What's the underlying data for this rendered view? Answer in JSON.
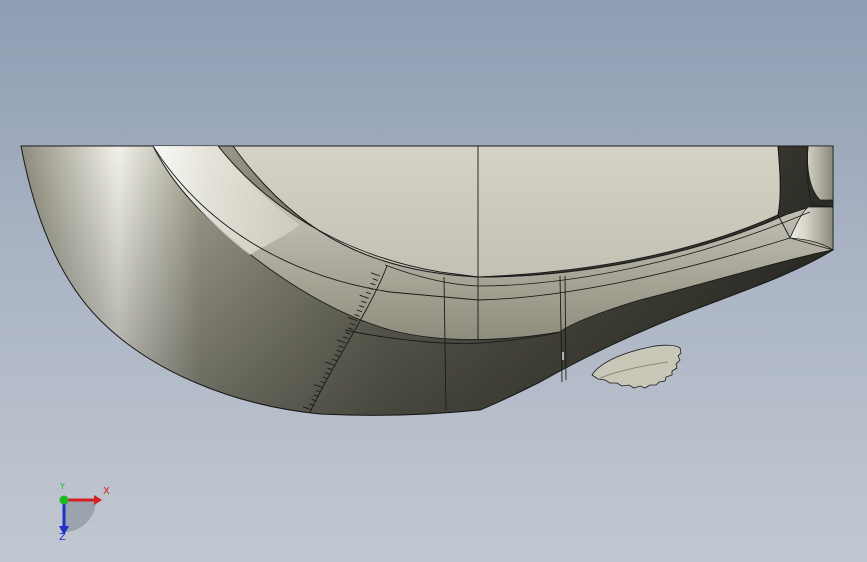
{
  "viewport": {
    "background_top": "#8f9db3",
    "background_bottom": "#c2c8d1",
    "model_color": "#c9c8ba",
    "edge_color": "#1a1a1a"
  },
  "triad": {
    "x_label": "X",
    "y_label": "Y",
    "z_label": "Z",
    "x_color": "#d42020",
    "y_color": "#1fb81f",
    "z_color": "#2030c8"
  }
}
